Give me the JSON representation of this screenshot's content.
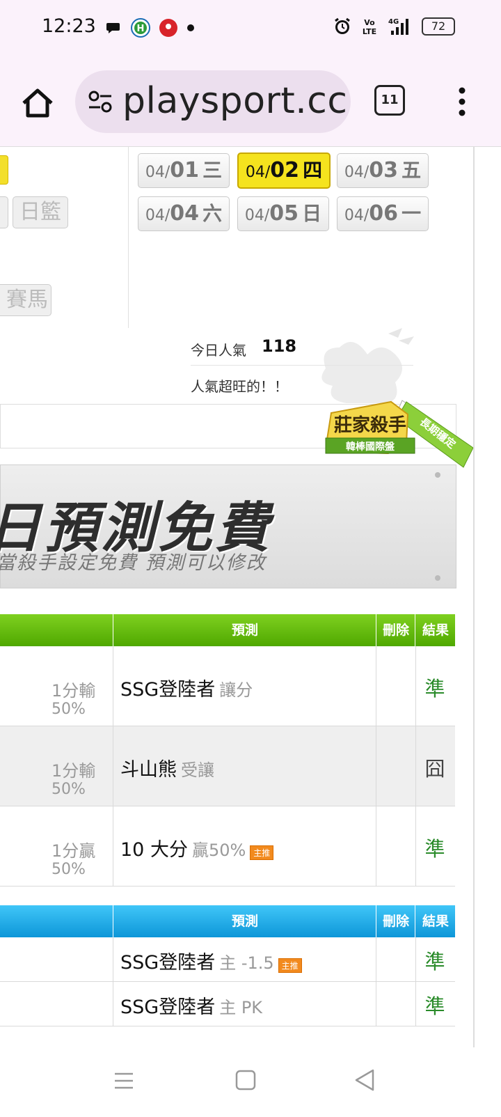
{
  "status": {
    "time": "12:23",
    "battery": "72",
    "network": "4G"
  },
  "browser": {
    "url": "playsport.cc",
    "tab_count": "11"
  },
  "left_nav": {
    "basketball": "日籃",
    "horse": "賽馬"
  },
  "dates": [
    {
      "month": "04/",
      "day": "01",
      "weekday": "三",
      "active": false
    },
    {
      "month": "04/",
      "day": "02",
      "weekday": "四",
      "active": true
    },
    {
      "month": "04/",
      "day": "03",
      "weekday": "五",
      "active": false
    },
    {
      "month": "04/",
      "day": "04",
      "weekday": "六",
      "active": false
    },
    {
      "month": "04/",
      "day": "05",
      "weekday": "日",
      "active": false
    },
    {
      "month": "04/",
      "day": "06",
      "weekday": "一",
      "active": false
    }
  ],
  "popularity": {
    "label": "今日人氣",
    "value": "118",
    "message": "人氣超旺的！！"
  },
  "badge": {
    "title": "莊家殺手",
    "subtitle": "韓棒國際盤",
    "ribbon": "長期穩定"
  },
  "banner": {
    "headline": "日預測免費",
    "subline": "當殺手設定免費  預測可以修改"
  },
  "table1": {
    "headers": {
      "predict": "預測",
      "delete": "刪除",
      "result": "結果"
    },
    "rows": [
      {
        "odds": "1分輸",
        "pct": "50%",
        "team": "SSG登陸者",
        "type": "讓分",
        "tag": "",
        "result": "準"
      },
      {
        "odds": "1分輸",
        "pct": "50%",
        "team": "斗山熊",
        "type": "受讓",
        "tag": "",
        "result": "囧"
      },
      {
        "odds": "1分贏",
        "pct": "50%",
        "team": "10 大分",
        "type": "贏50%",
        "tag": "主推",
        "result": "準"
      }
    ]
  },
  "table2": {
    "headers": {
      "predict": "預測",
      "delete": "刪除",
      "result": "結果"
    },
    "rows": [
      {
        "team": "SSG登陸者",
        "type": "主 -1.5",
        "tag": "主推",
        "result": "準"
      },
      {
        "team": "SSG登陸者",
        "type": "主 PK",
        "tag": "",
        "result": "準"
      }
    ]
  }
}
